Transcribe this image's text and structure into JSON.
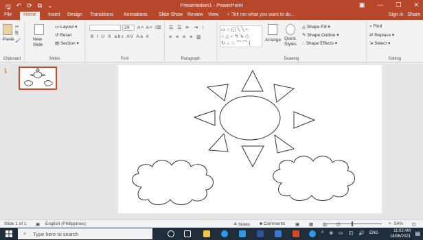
{
  "titlebar": {
    "title": "Presentation1  -  PowerPoint",
    "qat": [
      "save-icon",
      "undo-icon",
      "redo-icon",
      "slideshow-icon",
      "more-icon"
    ],
    "qat_glyphs": [
      "🖫",
      "↶",
      "⟳",
      "⧉",
      "⌄"
    ],
    "window_buttons": [
      "▣",
      "—",
      "❐",
      "✕"
    ]
  },
  "tabs": {
    "items": [
      "File",
      "Home",
      "Insert",
      "Design",
      "Transitions",
      "Animations",
      "Slide Show",
      "Review",
      "View"
    ],
    "tellme": "♀ Tell me what you want to do...",
    "signin": "Sign in",
    "share": "Share"
  },
  "ribbon": {
    "clipboard": {
      "paste": "Paste",
      "label": "Clipboard"
    },
    "slides": {
      "new_slide": "New\nSlide",
      "layout": "Layout",
      "reset": "Reset",
      "section": "Section",
      "label": "Slides"
    },
    "font": {
      "size": "24",
      "label": "Font",
      "format_row": "B I U S abc AV Aa A"
    },
    "paragraph": {
      "label": "Paragraph"
    },
    "drawing": {
      "arrange": "Arrange",
      "quick_styles": "Quick\nStyles",
      "shape_fill": "Shape Fill",
      "shape_outline": "Shape Outline",
      "shape_effects": "Shape Effects",
      "label": "Drawing"
    },
    "editing": {
      "find": "Find",
      "replace": "Replace",
      "select": "Select",
      "label": "Editing"
    }
  },
  "slides_panel": {
    "number": "1"
  },
  "statusbar": {
    "slide_info": "Slide 1 of 1",
    "language": "English (Philippines)",
    "notes": "Notes",
    "comments": "Comments",
    "zoom": "54%"
  },
  "taskbar": {
    "search_placeholder": "Type here to search",
    "time": "11:02 AM",
    "date": "18/06/2021",
    "lang": "ENG"
  }
}
